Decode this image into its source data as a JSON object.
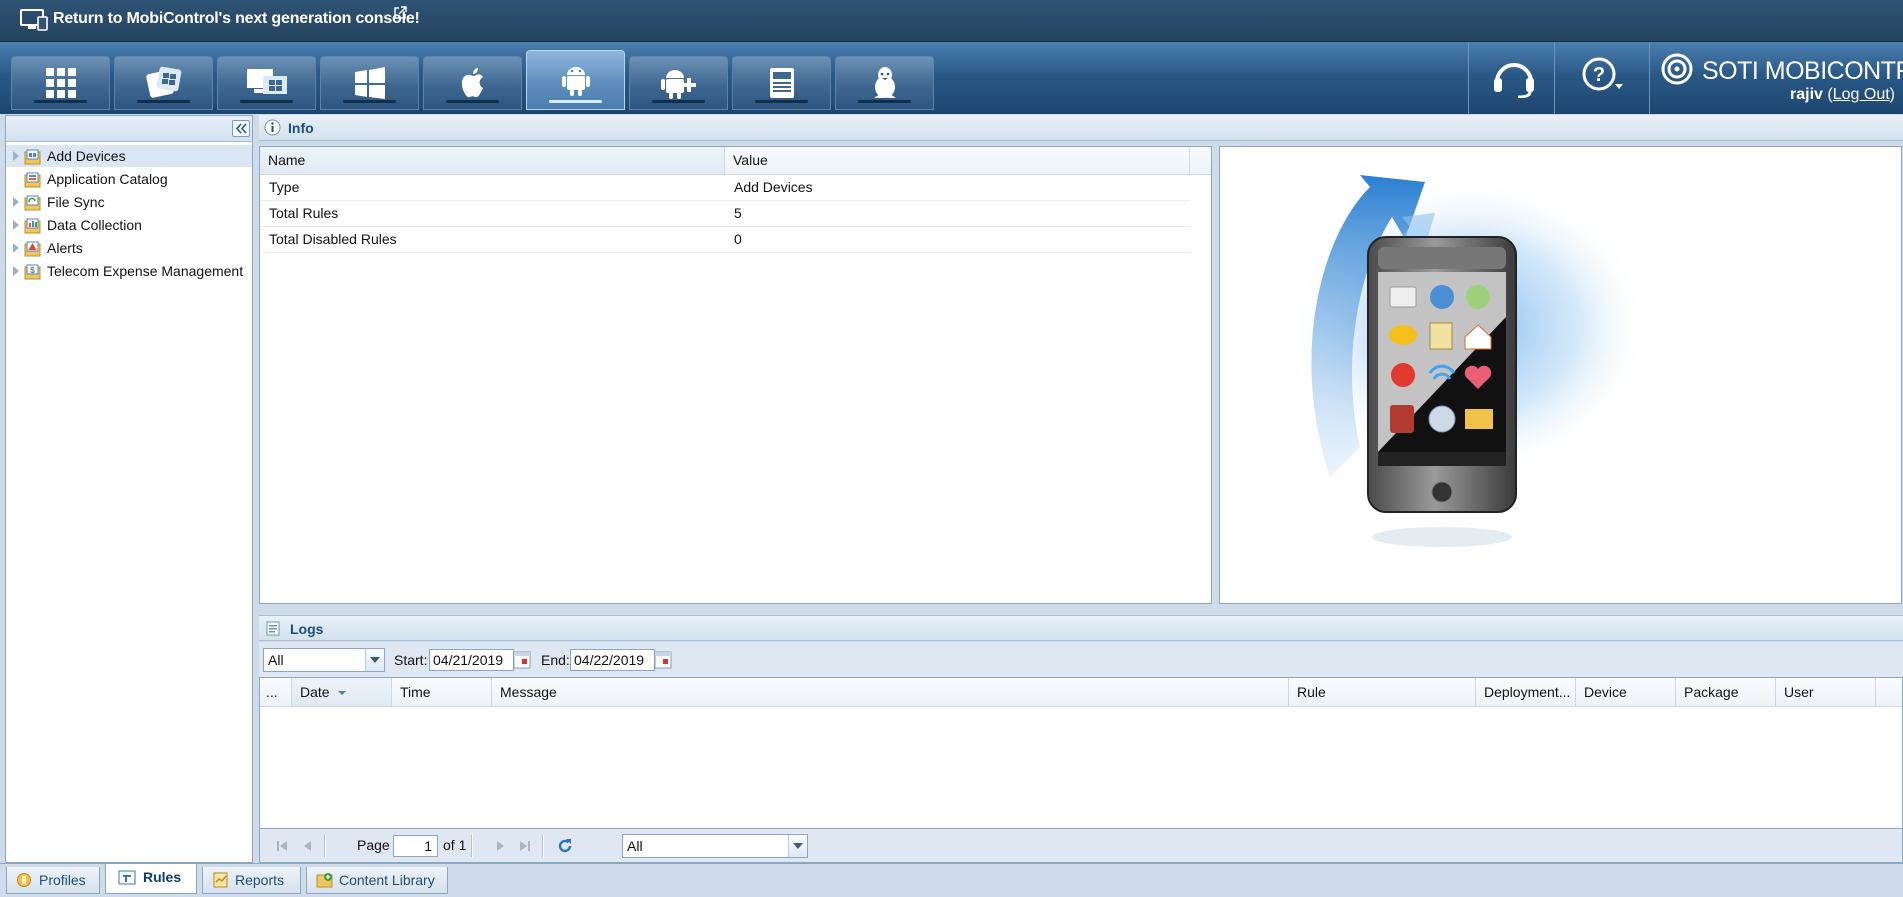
{
  "banner": {
    "text": "Return to MobiControl's next generation console!"
  },
  "toolbar": {
    "tabs": [
      {
        "name": "all-devices",
        "icon": "grid-icon"
      },
      {
        "name": "windows-mobile",
        "icon": "windows-mobile-icon"
      },
      {
        "name": "windows-desktop",
        "icon": "windows-desktop-icon"
      },
      {
        "name": "windows-modern",
        "icon": "windows-icon"
      },
      {
        "name": "apple",
        "icon": "apple-icon"
      },
      {
        "name": "android",
        "icon": "android-icon",
        "active": true
      },
      {
        "name": "android-plus",
        "icon": "android-plus-icon"
      },
      {
        "name": "printer",
        "icon": "printer-icon"
      },
      {
        "name": "linux",
        "icon": "linux-icon"
      }
    ],
    "brand": "SOTI MOBICONTROL",
    "user": "rajiv",
    "logout": "Log Out"
  },
  "left_tree": {
    "items": [
      {
        "label": "Add Devices",
        "expandable": true,
        "selected": true
      },
      {
        "label": "Application Catalog",
        "expandable": false
      },
      {
        "label": "File Sync",
        "expandable": true
      },
      {
        "label": "Data Collection",
        "expandable": true
      },
      {
        "label": "Alerts",
        "expandable": true
      },
      {
        "label": "Telecom Expense Management",
        "expandable": true
      }
    ]
  },
  "info": {
    "title": "Info",
    "columns": [
      "Name",
      "Value"
    ],
    "rows": [
      [
        "Type",
        "Add Devices"
      ],
      [
        "Total Rules",
        "5"
      ],
      [
        "Total Disabled Rules",
        "0"
      ]
    ]
  },
  "logs": {
    "title": "Logs",
    "filter_value": "All",
    "start_label": "Start:",
    "start_date": "04/21/2019",
    "end_label": "End:",
    "end_date": "04/22/2019",
    "columns": [
      "...",
      "Date",
      "Time",
      "Message",
      "Rule",
      "Deployment...",
      "Device",
      "Package",
      "User"
    ],
    "pager": {
      "page_label": "Page",
      "page": "1",
      "of_label": "of 1",
      "page_size": "All"
    }
  },
  "bottom_tabs": [
    {
      "label": "Profiles",
      "icon": "profiles-icon"
    },
    {
      "label": "Rules",
      "icon": "rules-icon",
      "active": true
    },
    {
      "label": "Reports",
      "icon": "reports-icon"
    },
    {
      "label": "Content Library",
      "icon": "content-library-icon"
    }
  ],
  "colors": {
    "accent": "#1d4d79",
    "toolbar": "#2a5986",
    "banner": "#2f5375",
    "panel_border": "#8aa7c3"
  }
}
